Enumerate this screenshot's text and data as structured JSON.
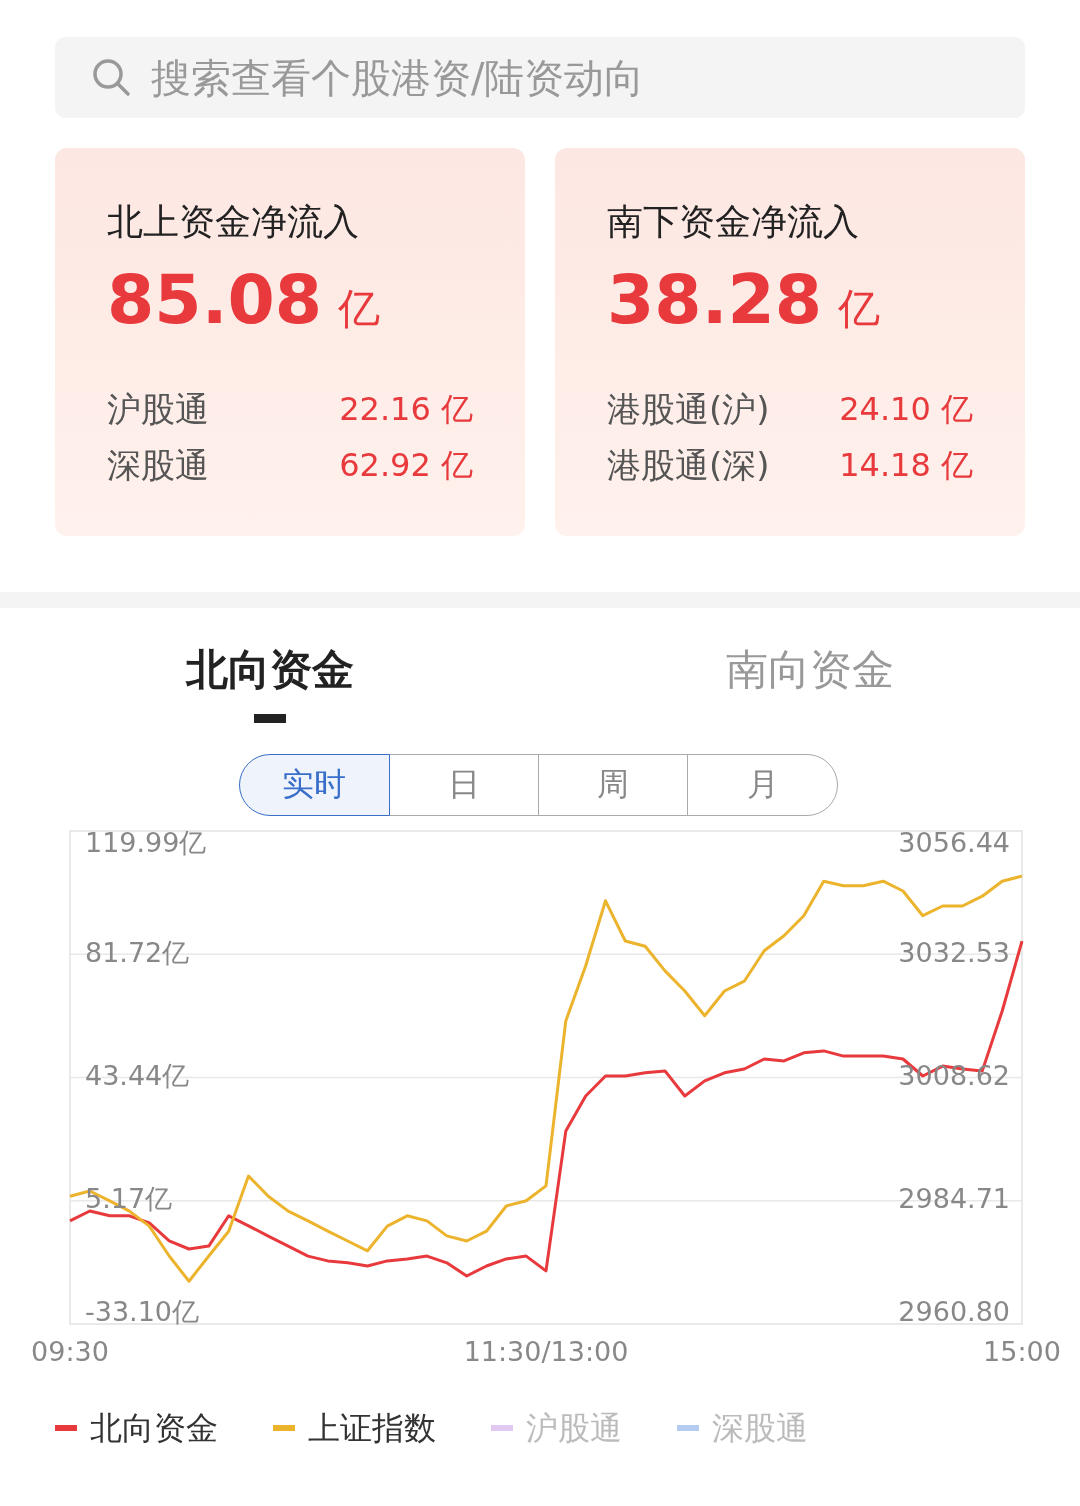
{
  "search": {
    "placeholder": "搜索查看个股港资/陆资动向"
  },
  "cards": [
    {
      "title": "北上资金净流入",
      "amount": "85.08",
      "unit": "亿",
      "rows": [
        {
          "label": "沪股通",
          "value": "22.16 亿"
        },
        {
          "label": "深股通",
          "value": "62.92 亿"
        }
      ]
    },
    {
      "title": "南下资金净流入",
      "amount": "38.28",
      "unit": "亿",
      "rows": [
        {
          "label": "港股通(沪)",
          "value": "24.10 亿"
        },
        {
          "label": "港股通(深)",
          "value": "14.18 亿"
        }
      ]
    }
  ],
  "tabs": [
    {
      "label": "北向资金",
      "selected": true
    },
    {
      "label": "南向资金",
      "selected": false
    }
  ],
  "periods": [
    {
      "label": "实时",
      "selected": true
    },
    {
      "label": "日",
      "selected": false
    },
    {
      "label": "周",
      "selected": false
    },
    {
      "label": "月",
      "selected": false
    }
  ],
  "chart": {
    "chart_data": {
      "type": "line",
      "categories": [
        "09:30",
        null,
        null,
        null,
        null,
        null,
        null,
        null,
        null,
        null,
        null,
        null,
        null,
        null,
        null,
        null,
        null,
        null,
        null,
        null,
        null,
        null,
        null,
        null,
        "11:30/13:00",
        null,
        null,
        null,
        null,
        null,
        null,
        null,
        null,
        null,
        null,
        null,
        null,
        null,
        null,
        null,
        null,
        null,
        null,
        null,
        null,
        null,
        null,
        null,
        "15:00"
      ],
      "grid": true,
      "ylim": [
        -33.1,
        119.99
      ],
      "y2lim": [
        2960.8,
        3056.44
      ],
      "yticks": [
        {
          "value": -33.1,
          "label": "-33.10亿"
        },
        {
          "value": 5.17,
          "label": "5.17亿"
        },
        {
          "value": 43.44,
          "label": "43.44亿"
        },
        {
          "value": 81.72,
          "label": "81.72亿"
        },
        {
          "value": 119.99,
          "label": "119.99亿"
        }
      ],
      "y2ticks": [
        {
          "value": 2960.8,
          "label": "2960.80"
        },
        {
          "value": 2984.71,
          "label": "2984.71"
        },
        {
          "value": 3008.62,
          "label": "3008.62"
        },
        {
          "value": 3032.53,
          "label": "3032.53"
        },
        {
          "value": 3056.44,
          "label": "3056.44"
        }
      ],
      "series": [
        {
          "name": "北向资金",
          "color": "#e8393c",
          "values": [
            -1.1,
            2.0,
            0.5,
            0.5,
            -1.7,
            -7.3,
            -9.8,
            -8.9,
            0.5,
            -2.6,
            -5.8,
            -8.9,
            -12.0,
            -13.5,
            -14.1,
            -15.1,
            -13.5,
            -12.9,
            -12.0,
            -14.1,
            -18.2,
            -15.1,
            -12.9,
            -12.0,
            -16.6,
            26.8,
            37.7,
            43.9,
            43.9,
            44.9,
            45.5,
            37.7,
            42.4,
            44.9,
            46.1,
            49.2,
            48.6,
            51.1,
            51.7,
            50.1,
            50.1,
            50.1,
            49.2,
            43.9,
            47.0,
            46.1,
            45.5,
            64.1,
            85.8
          ]
        },
        {
          "name": "上证指数",
          "color": "#ecb32d",
          "axis": "y2",
          "values": [
            2985.6,
            2986.6,
            2984.7,
            2982.7,
            2979.8,
            2974.0,
            2969.1,
            2974.0,
            2978.8,
            2989.5,
            2985.6,
            2982.7,
            2980.8,
            2978.8,
            2976.9,
            2975.0,
            2979.8,
            2981.8,
            2980.8,
            2977.9,
            2976.9,
            2978.8,
            2983.7,
            2984.7,
            2987.6,
            3019.6,
            3030.3,
            3042.9,
            3035.1,
            3034.1,
            3029.3,
            3025.4,
            3020.6,
            3025.4,
            3027.3,
            3033.2,
            3036.1,
            3040.0,
            3046.7,
            3045.8,
            3045.8,
            3046.7,
            3044.8,
            3040.0,
            3041.9,
            3041.9,
            3043.8,
            3046.7,
            3047.7
          ]
        }
      ]
    }
  },
  "legend": [
    {
      "selected": true
    },
    {
      "selected": true
    },
    {
      "label": "沪股通",
      "color": "#e2c9f2",
      "selected": false
    },
    {
      "label": "深股通",
      "color": "#b5ccf2",
      "selected": false
    }
  ]
}
